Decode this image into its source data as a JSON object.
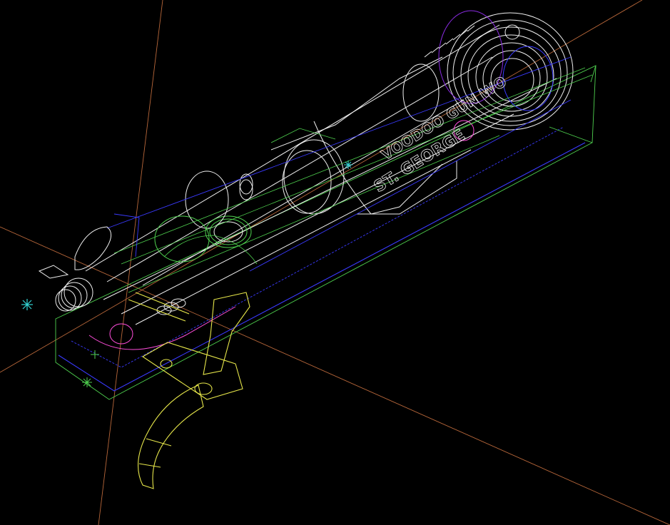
{
  "view": {
    "background": "#000000",
    "projection": "isometric wireframe"
  },
  "colors": {
    "axis": "#b8673a",
    "body": "#f0f0f0",
    "green": "#4fd14f",
    "blue": "#3a3aff",
    "yellow": "#e6e64a",
    "magenta": "#ff4ddb",
    "cyan": "#33d6d6",
    "violet": "#8a2be2"
  },
  "engraving": {
    "line1": "VOODOO GUN WO",
    "line2": "ST. GEORGE"
  },
  "markers": [
    "cursor-star-icon",
    "origin-cross-icon"
  ]
}
